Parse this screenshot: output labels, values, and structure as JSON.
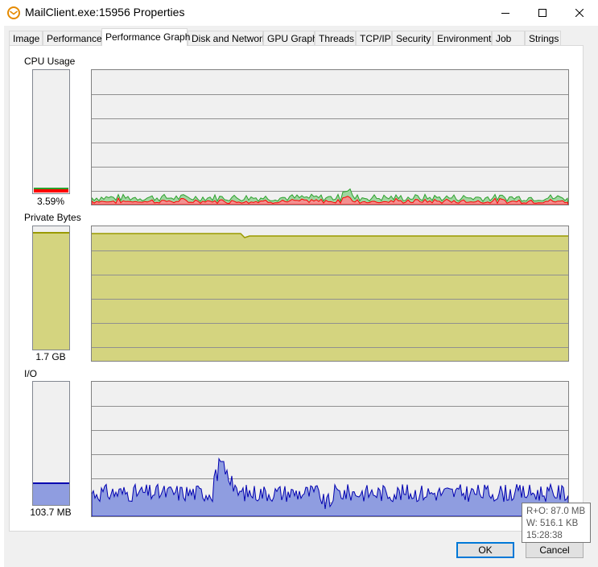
{
  "window": {
    "title": "MailClient.exe:15956 Properties",
    "icon": "envelope-app-icon",
    "controls": {
      "minimize": "minimize-icon",
      "maximize": "maximize-icon",
      "close": "close-icon"
    }
  },
  "tabs": [
    {
      "label": "Image",
      "active": false
    },
    {
      "label": "Performance",
      "active": false
    },
    {
      "label": "Performance Graph",
      "active": true
    },
    {
      "label": "Disk and Network",
      "active": false
    },
    {
      "label": "GPU Graph",
      "active": false
    },
    {
      "label": "Threads",
      "active": false
    },
    {
      "label": "TCP/IP",
      "active": false
    },
    {
      "label": "Security",
      "active": false
    },
    {
      "label": "Environment",
      "active": false
    },
    {
      "label": "Job",
      "active": false
    },
    {
      "label": "Strings",
      "active": false
    }
  ],
  "cpu": {
    "label": "CPU Usage",
    "value": "3.59%",
    "level_fraction": 0.036,
    "colors": {
      "total": "#2ca02c",
      "kernel": "#ff0000"
    }
  },
  "private_bytes": {
    "label": "Private Bytes",
    "value": "1.7 GB",
    "level_fraction": 0.94,
    "colors": {
      "fill": "#d4d47f",
      "line": "#9a9a00"
    }
  },
  "io": {
    "label": "I/O",
    "value": "103.7  MB",
    "level_fraction": 0.17,
    "colors": {
      "fill": "#8f9de0",
      "line": "#0000b0"
    }
  },
  "tooltip": {
    "line1": "R+O: 87.0  MB",
    "line2": "W: 516.1  KB",
    "line3": "15:28:38"
  },
  "buttons": {
    "ok": "OK",
    "cancel": "Cancel"
  }
}
